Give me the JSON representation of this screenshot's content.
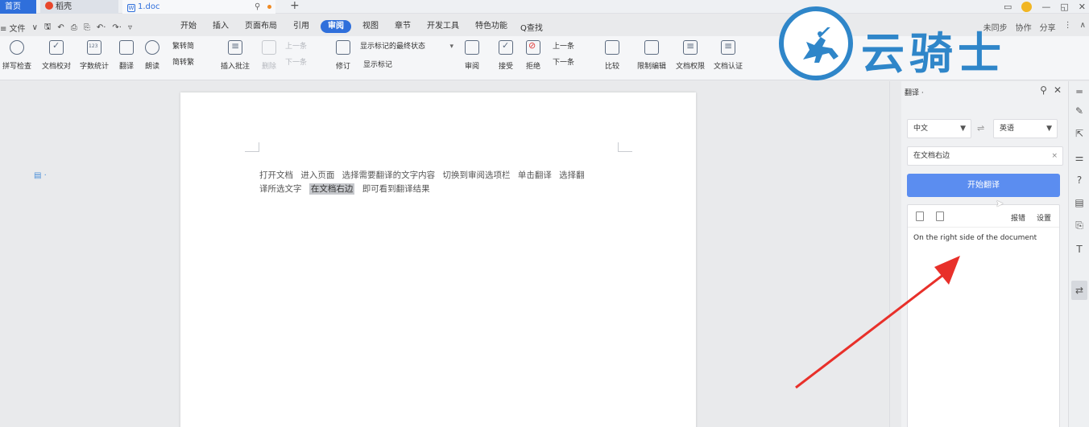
{
  "tabs": {
    "home": "首页",
    "daoke": "稻壳",
    "doc": "1.doc",
    "new_tab": "+"
  },
  "window": {
    "controls": [
      "▭",
      "—",
      "◱",
      "✕"
    ]
  },
  "menu": {
    "file": "≡ 文件",
    "file_caret": "∨",
    "quick_icons": [
      "🖫",
      "↶",
      "⎙",
      "⎘",
      "↶·",
      "↷·",
      "▿"
    ],
    "items": [
      "开始",
      "插入",
      "页面布局",
      "引用",
      "审阅",
      "视图",
      "章节",
      "开发工具",
      "特色功能"
    ],
    "active": "审阅",
    "search": "Q查找",
    "right": [
      "未同步",
      "协作",
      "分享",
      "⋮",
      "∧"
    ]
  },
  "ribbon": {
    "buttons": [
      {
        "label": "拼写检查",
        "icon": "spellcheck-icon"
      },
      {
        "label": "文档校对",
        "icon": "proofread-icon"
      },
      {
        "label": "字数统计",
        "icon": "wordcount-icon"
      },
      {
        "label": "翻译",
        "icon": "translate-icon"
      },
      {
        "label": "朗读",
        "icon": "read-aloud-icon"
      }
    ],
    "trad_simp": {
      "to_trad": "繁转简",
      "to_simp": "简转繁"
    },
    "comment": {
      "insert": "插入批注",
      "delete": "删除",
      "prev": "上一条",
      "next": "下一条"
    },
    "revise": {
      "label": "修订",
      "mode": "显示标记的最终状态",
      "show_marks": "显示标记"
    },
    "review": {
      "label": "审阅",
      "accept": "接受",
      "reject": "拒绝",
      "prev": "上一条",
      "next": "下一条"
    },
    "compare": "比较",
    "restrict": "限制编辑",
    "permission": "文档权限",
    "cert": "文档认证"
  },
  "watermark": {
    "text": "云骑士"
  },
  "document": {
    "line1": "打开文档  进入页面  选择需要翻译的文字内容  切换到审阅选项栏  单击翻译  选择翻",
    "line2_pre": "译所选文字",
    "highlight": "在文档右边",
    "line2_post": "即可看到翻译结果"
  },
  "translate_pane": {
    "title": "翻译 ·",
    "source_lang": "中文",
    "target_lang": "英语",
    "input_text": "在文档右边",
    "button": "开始翻译",
    "report": "报错",
    "settings": "设置",
    "result": "On the right side of the document"
  },
  "colors": {
    "accent": "#2f6fdb",
    "button": "#5b8df0",
    "watermark": "#2f86c9",
    "arrow": "#e8302a"
  }
}
